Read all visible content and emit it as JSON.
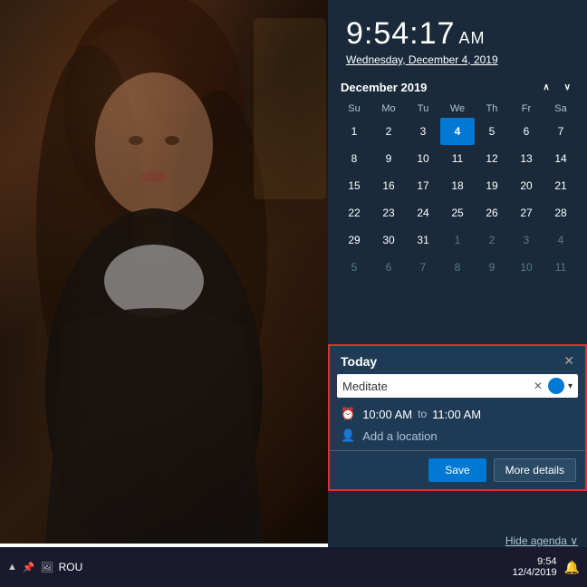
{
  "clock": {
    "time": "9:54:17",
    "ampm": "AM",
    "date": "Wednesday, December 4, 2019"
  },
  "calendar": {
    "month_year": "December 2019",
    "nav_up": "∧",
    "nav_down": "∨",
    "days_header": [
      "Su",
      "Mo",
      "Tu",
      "We",
      "Th",
      "Fr",
      "Sa"
    ],
    "weeks": [
      [
        {
          "label": "1",
          "class": ""
        },
        {
          "label": "2",
          "class": ""
        },
        {
          "label": "3",
          "class": ""
        },
        {
          "label": "4",
          "class": "today"
        },
        {
          "label": "5",
          "class": ""
        },
        {
          "label": "6",
          "class": ""
        },
        {
          "label": "7",
          "class": ""
        }
      ],
      [
        {
          "label": "8",
          "class": ""
        },
        {
          "label": "9",
          "class": ""
        },
        {
          "label": "10",
          "class": ""
        },
        {
          "label": "11",
          "class": ""
        },
        {
          "label": "12",
          "class": ""
        },
        {
          "label": "13",
          "class": ""
        },
        {
          "label": "14",
          "class": ""
        }
      ],
      [
        {
          "label": "15",
          "class": ""
        },
        {
          "label": "16",
          "class": ""
        },
        {
          "label": "17",
          "class": ""
        },
        {
          "label": "18",
          "class": ""
        },
        {
          "label": "19",
          "class": ""
        },
        {
          "label": "20",
          "class": ""
        },
        {
          "label": "21",
          "class": ""
        }
      ],
      [
        {
          "label": "22",
          "class": ""
        },
        {
          "label": "23",
          "class": ""
        },
        {
          "label": "24",
          "class": ""
        },
        {
          "label": "25",
          "class": ""
        },
        {
          "label": "26",
          "class": ""
        },
        {
          "label": "27",
          "class": ""
        },
        {
          "label": "28",
          "class": ""
        }
      ],
      [
        {
          "label": "29",
          "class": ""
        },
        {
          "label": "30",
          "class": ""
        },
        {
          "label": "31",
          "class": ""
        },
        {
          "label": "1",
          "class": "other-month"
        },
        {
          "label": "2",
          "class": "other-month"
        },
        {
          "label": "3",
          "class": "other-month"
        },
        {
          "label": "4",
          "class": "other-month"
        }
      ],
      [
        {
          "label": "5",
          "class": "other-month"
        },
        {
          "label": "6",
          "class": "other-month"
        },
        {
          "label": "7",
          "class": "other-month"
        },
        {
          "label": "8",
          "class": "other-month"
        },
        {
          "label": "9",
          "class": "other-month"
        },
        {
          "label": "10",
          "class": "other-month"
        },
        {
          "label": "11",
          "class": "other-month"
        }
      ]
    ]
  },
  "today_panel": {
    "title": "Today",
    "close_label": "✕",
    "event_name": "Meditate",
    "event_placeholder": "Meditate",
    "clear_icon": "✕",
    "time_from": "10:00 AM",
    "time_to_label": "to",
    "time_to": "11:00 AM",
    "location_placeholder": "Add a location",
    "save_label": "Save",
    "more_details_label": "More details"
  },
  "hide_agenda": {
    "label": "Hide agenda ∨"
  },
  "taskbar": {
    "time": "9:54",
    "date": "12/4/2019",
    "icons": [
      "▲",
      "📌",
      "🖼",
      "ROU",
      "🔔"
    ]
  }
}
